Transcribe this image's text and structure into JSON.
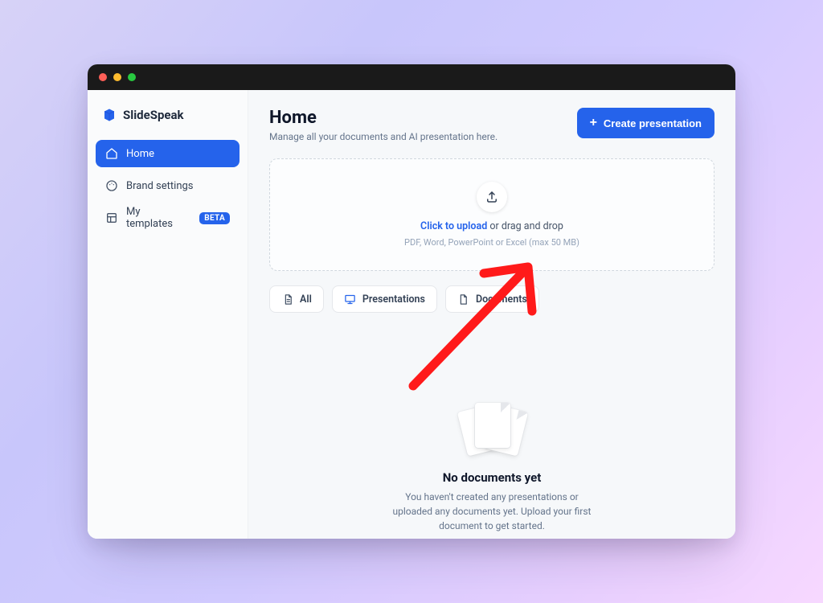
{
  "brand": {
    "name": "SlideSpeak"
  },
  "sidebar": {
    "items": [
      {
        "label": "Home",
        "badge": null
      },
      {
        "label": "Brand settings",
        "badge": null
      },
      {
        "label": "My templates",
        "badge": "BETA"
      }
    ]
  },
  "header": {
    "title": "Home",
    "subtitle": "Manage all your documents and AI presentation here.",
    "create_label": "Create presentation"
  },
  "uploader": {
    "cta": "Click to upload",
    "rest": " or drag and drop",
    "hint": "PDF, Word, PowerPoint or Excel (max 50 MB)"
  },
  "tabs": [
    {
      "label": "All"
    },
    {
      "label": "Presentations"
    },
    {
      "label": "Documents"
    }
  ],
  "empty": {
    "title": "No documents yet",
    "body": "You haven't created any presentations or uploaded any documents yet. Upload your first document to get started."
  }
}
